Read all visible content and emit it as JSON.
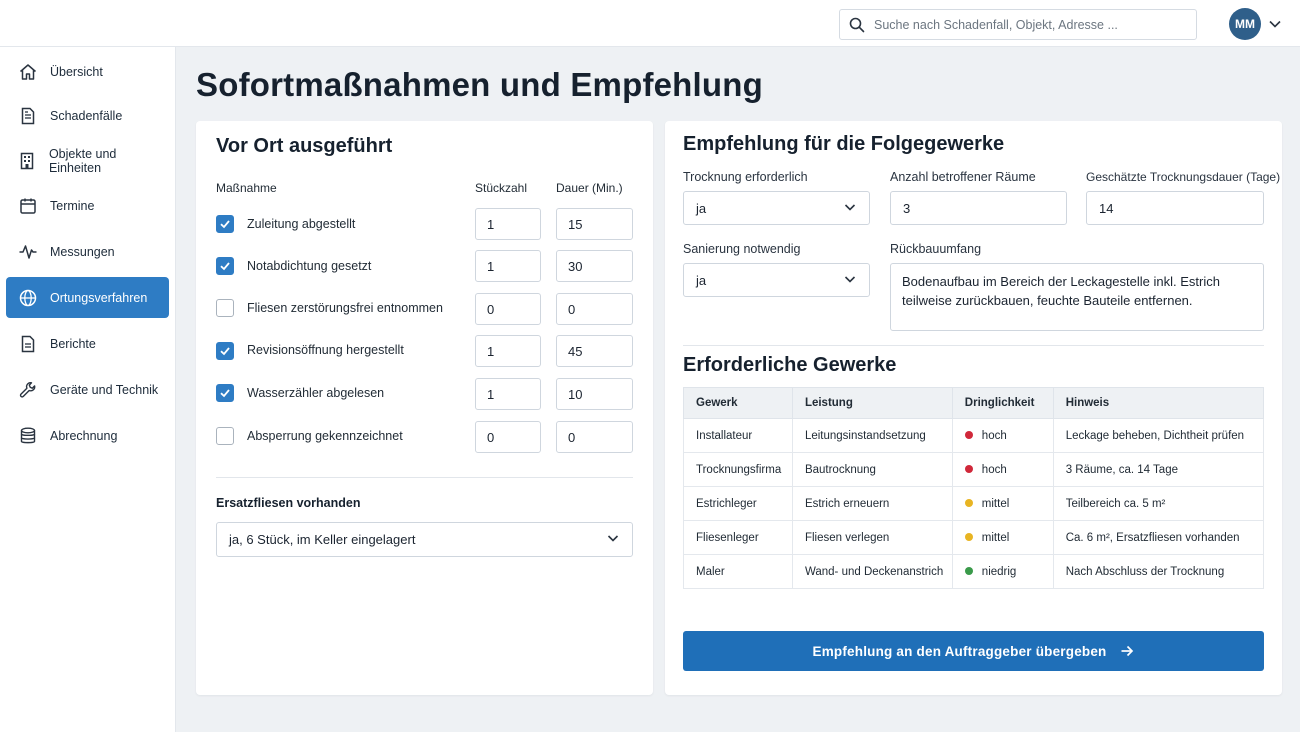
{
  "search": {
    "placeholder": "Suche nach Schadenfall, Objekt, Adresse ..."
  },
  "user": {
    "initials": "MM"
  },
  "sidebar": {
    "items": [
      {
        "label": "Übersicht",
        "icon": "home-icon"
      },
      {
        "label": "Schadenfälle",
        "icon": "document-icon"
      },
      {
        "label": "Objekte und Einheiten",
        "icon": "building-icon"
      },
      {
        "label": "Termine",
        "icon": "calendar-icon"
      },
      {
        "label": "Messungen",
        "icon": "pulse-icon"
      },
      {
        "label": "Ortungsverfahren",
        "icon": "globe-icon",
        "active": true
      },
      {
        "label": "Berichte",
        "icon": "report-icon"
      },
      {
        "label": "Geräte und Technik",
        "icon": "wrench-icon"
      },
      {
        "label": "Abrechnung",
        "icon": "database-icon"
      }
    ]
  },
  "page": {
    "title": "Sofortmaßnahmen und Empfehlung"
  },
  "left_card": {
    "title": "Vor Ort ausgeführt",
    "columns": {
      "measure": "Maßnahme",
      "count": "Stückzahl",
      "duration": "Dauer (Min.)"
    },
    "rows": [
      {
        "label": "Zuleitung abgestellt",
        "checked": true,
        "count": "1",
        "duration": "15"
      },
      {
        "label": "Notabdichtung gesetzt",
        "checked": true,
        "count": "1",
        "duration": "30"
      },
      {
        "label": "Fliesen zerstörungsfrei entnommen",
        "checked": false,
        "count": "0",
        "duration": "0"
      },
      {
        "label": "Revisionsöffnung hergestellt",
        "checked": true,
        "count": "1",
        "duration": "45"
      },
      {
        "label": "Wasserzähler abgelesen",
        "checked": true,
        "count": "1",
        "duration": "10"
      },
      {
        "label": "Absperrung gekennzeichnet",
        "checked": false,
        "count": "0",
        "duration": "0"
      }
    ],
    "spare_tiles": {
      "label": "Ersatzfliesen vorhanden",
      "value": "ja, 6 Stück, im Keller eingelagert"
    }
  },
  "right_card": {
    "title": "Empfehlung für die Folgegewerke",
    "drying": {
      "label": "Trocknung erforderlich",
      "value": "ja"
    },
    "rooms": {
      "label": "Anzahl betroffener Räume",
      "value": "3"
    },
    "drying_days": {
      "label": "Geschätzte Trocknungsdauer (Tage)",
      "value": "14"
    },
    "renovation": {
      "label": "Sanierung notwendig",
      "value": "ja"
    },
    "dismantling": {
      "label": "Rückbauumfang",
      "value": "Bodenaufbau im Bereich der Leckagestelle inkl. Estrich teilweise zurückbauen, feuchte Bauteile entfernen."
    },
    "trades_title": "Erforderliche Gewerke",
    "table": {
      "headers": [
        "Gewerk",
        "Leistung",
        "Dringlichkeit",
        "Hinweis"
      ],
      "rows": [
        {
          "trade": "Installateur",
          "service": "Leitungsinstandsetzung",
          "urgency": "hoch",
          "urgency_color": "#d0283a",
          "note": "Leckage beheben, Dichtheit prüfen"
        },
        {
          "trade": "Trocknungsfirma",
          "service": "Bautrocknung",
          "urgency": "hoch",
          "urgency_color": "#d0283a",
          "note": "3 Räume, ca. 14 Tage"
        },
        {
          "trade": "Estrichleger",
          "service": "Estrich erneuern",
          "urgency": "mittel",
          "urgency_color": "#e8b422",
          "note": "Teilbereich ca. 5 m²"
        },
        {
          "trade": "Fliesenleger",
          "service": "Fliesen verlegen",
          "urgency": "mittel",
          "urgency_color": "#e8b422",
          "note": "Ca. 6 m², Ersatzfliesen vorhanden"
        },
        {
          "trade": "Maler",
          "service": "Wand- und Deckenanstrich",
          "urgency": "niedrig",
          "urgency_color": "#3a9a4a",
          "note": "Nach Abschluss der Trocknung"
        }
      ]
    },
    "submit_label": "Empfehlung an den Auftraggeber übergeben"
  },
  "colors": {
    "accent": "#2e7cc4",
    "primary_button": "#1f6fb8",
    "avatar": "#2f5f8a"
  }
}
